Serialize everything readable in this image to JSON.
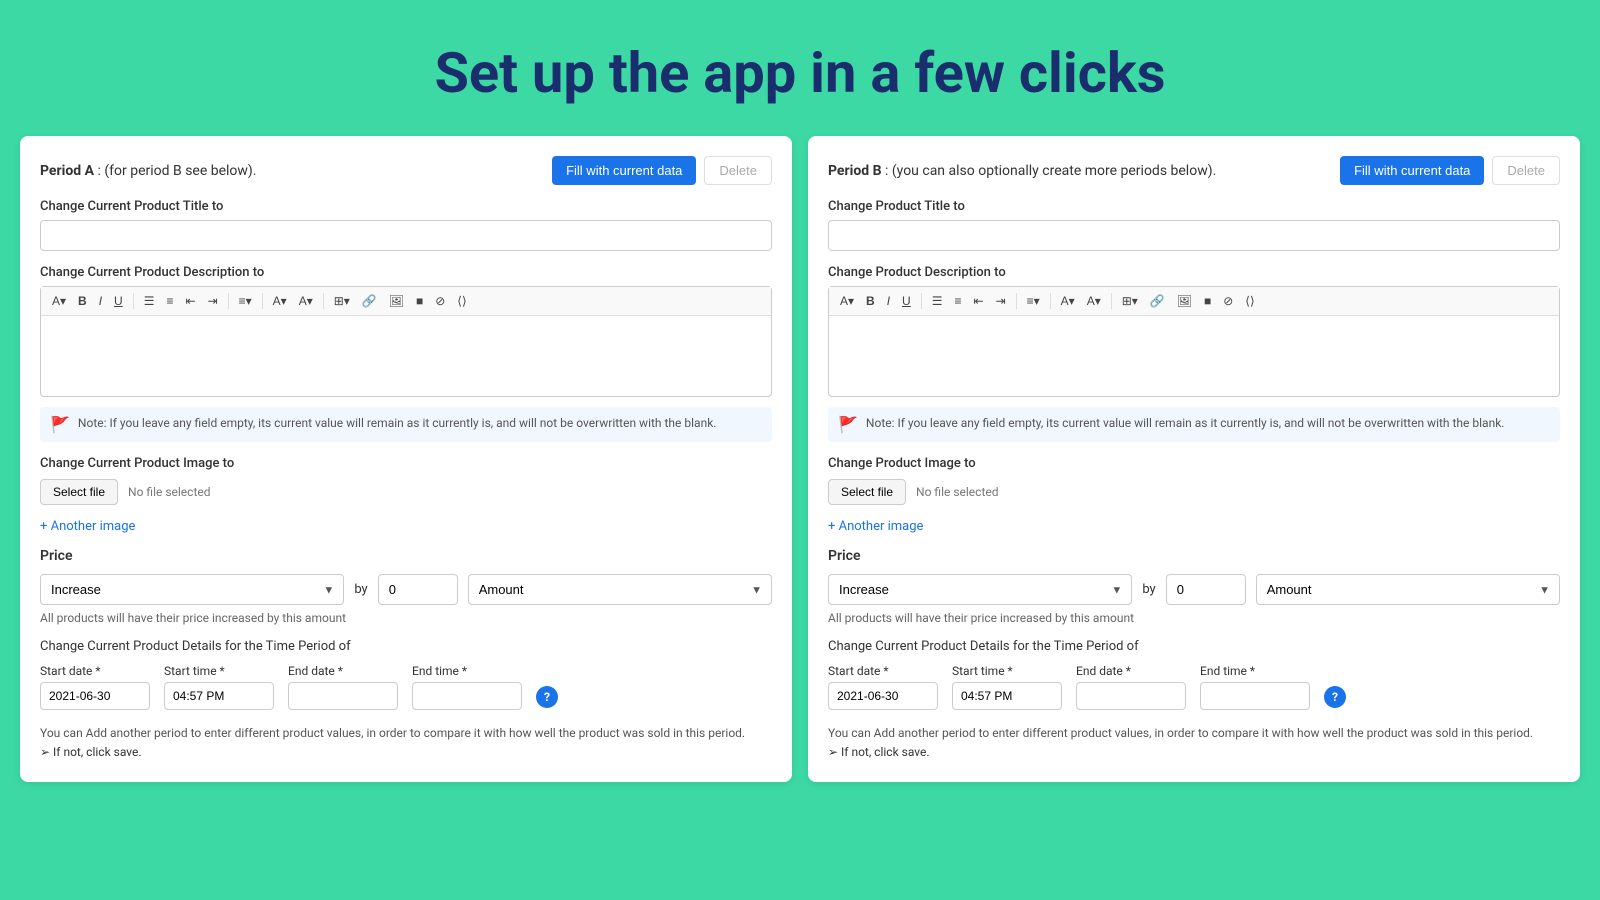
{
  "header": {
    "title": "Set up the app in a few clicks",
    "bg_color": "#3dd9a4",
    "title_color": "#1a2e6e"
  },
  "panel_a": {
    "period_label": "Period A",
    "period_sub": ": (for period B see below).",
    "fill_button": "Fill with current data",
    "delete_button": "Delete",
    "title_field_label": "Change Current Product Title to",
    "title_field_placeholder": "",
    "description_field_label": "Change Current Product Description to",
    "note_text": "Note: If you leave any field empty, its current value will remain as it currently is, and will not be overwritten with the blank.",
    "image_section_label": "Change Current Product Image to",
    "select_file_label": "Select file",
    "no_file_label": "No file selected",
    "add_image_label": "+ Another image",
    "price_label": "Price",
    "price_increase_option": "Increase",
    "price_by_label": "by",
    "price_amount_value": "0",
    "amount_label": "Amount",
    "price_note": "All products will have their price increased by this amount",
    "period_details_label": "Change Current Product Details for the Time Period of",
    "start_date_label": "Start date *",
    "start_time_label": "Start time *",
    "end_date_label": "End date *",
    "end_time_label": "End time *",
    "start_date_value": "2021-06-30",
    "start_time_value": "04:57 PM",
    "end_date_value": "",
    "end_time_value": "",
    "footer_note": "You can Add another period to enter different product values, in order to compare it with how well the product was sold in this period.",
    "footer_sub": "➢ If not, click save.",
    "toolbar_items": [
      "A▾",
      "B",
      "I",
      "U",
      "≡",
      "≡",
      "⊞",
      "⊠",
      "≡▾",
      "A▾",
      "A▾",
      "⊟▾",
      "🔗",
      "🖼",
      "■",
      "⊘",
      "⟨⟩"
    ]
  },
  "panel_b": {
    "period_label": "Period B",
    "period_sub": ": (you can also optionally create more periods below).",
    "fill_button": "Fill with current data",
    "delete_button": "Delete",
    "title_field_label": "Change Product Title to",
    "title_field_placeholder": "",
    "description_field_label": "Change Product Description to",
    "note_text": "Note: If you leave any field empty, its current value will remain as it currently is, and will not be overwritten with the blank.",
    "image_section_label": "Change Product Image to",
    "select_file_label": "Select file",
    "no_file_label": "No file selected",
    "add_image_label": "+ Another image",
    "price_label": "Price",
    "price_increase_option": "Increase",
    "price_by_label": "by",
    "price_amount_value": "0",
    "amount_label": "Amount",
    "price_note": "All products will have their price increased by this amount",
    "period_details_label": "Change Current Product Details for the Time Period of",
    "start_date_label": "Start date *",
    "start_time_label": "Start time *",
    "end_date_label": "End date *",
    "end_time_label": "End time *",
    "start_date_value": "2021-06-30",
    "start_time_value": "04:57 PM",
    "end_date_value": "",
    "end_time_value": "",
    "footer_note": "You can Add another period to enter different product values, in order to compare it with how well the product was sold in this period.",
    "footer_sub": "➢ If not, click save.",
    "toolbar_items": [
      "A▾",
      "B",
      "I",
      "U",
      "≡",
      "≡",
      "⊞",
      "⊠",
      "≡▾",
      "A▾",
      "A▾",
      "⊟▾",
      "🔗",
      "🖼",
      "■",
      "⊘",
      "⟨⟩"
    ]
  }
}
